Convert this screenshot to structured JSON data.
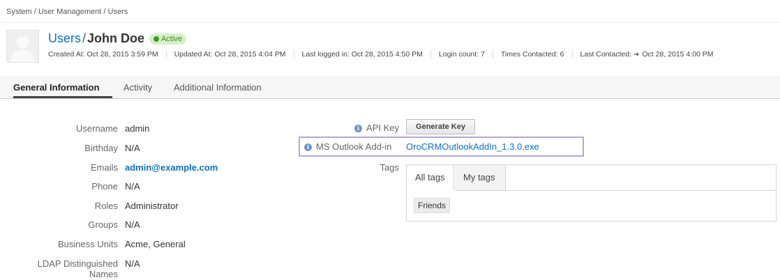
{
  "breadcrumb": "System / User Management / Users",
  "header": {
    "section_link": "Users",
    "separator": "/",
    "name": "John Doe",
    "status": "Active"
  },
  "meta": {
    "created": "Created At: Oct 28, 2015 3:59 PM",
    "updated": "Updated At: Oct 28, 2015 4:04 PM",
    "last_logged": "Last logged in: Oct 28, 2015 4:50 PM",
    "login_count": "Login count: 7",
    "times_contacted": "Times Contacted: 6",
    "last_contacted_label": "Last Contacted:",
    "last_contacted_value": "Oct 28, 2015 4:00 PM"
  },
  "tabs": [
    {
      "label": "General Information",
      "active": true
    },
    {
      "label": "Activity"
    },
    {
      "label": "Additional Information"
    }
  ],
  "fields": {
    "username": {
      "label": "Username",
      "value": "admin"
    },
    "birthday": {
      "label": "Birthday",
      "value": "N/A"
    },
    "emails": {
      "label": "Emails",
      "value": "admin@example.com"
    },
    "phone": {
      "label": "Phone",
      "value": "N/A"
    },
    "roles": {
      "label": "Roles",
      "value": "Administrator"
    },
    "groups": {
      "label": "Groups",
      "value": "N/A"
    },
    "business_units": {
      "label": "Business Units",
      "value": "Acme, General"
    },
    "ldap": {
      "label_line1": "LDAP Distinguished",
      "label_line2": "Names",
      "value": "N/A"
    }
  },
  "api": {
    "label": "API Key",
    "button": "Generate Key"
  },
  "outlook": {
    "label": "MS Outlook Add-in",
    "link": "OroCRMOutlookAddIn_1.3.0.exe"
  },
  "tags": {
    "label": "Tags",
    "tab_all": "All tags",
    "tab_mine": "My tags",
    "items": [
      "Friends"
    ]
  },
  "colors": {
    "link": "#0c72bd",
    "status_bg": "#d7f0c9",
    "highlight": "#b3a9d8"
  }
}
